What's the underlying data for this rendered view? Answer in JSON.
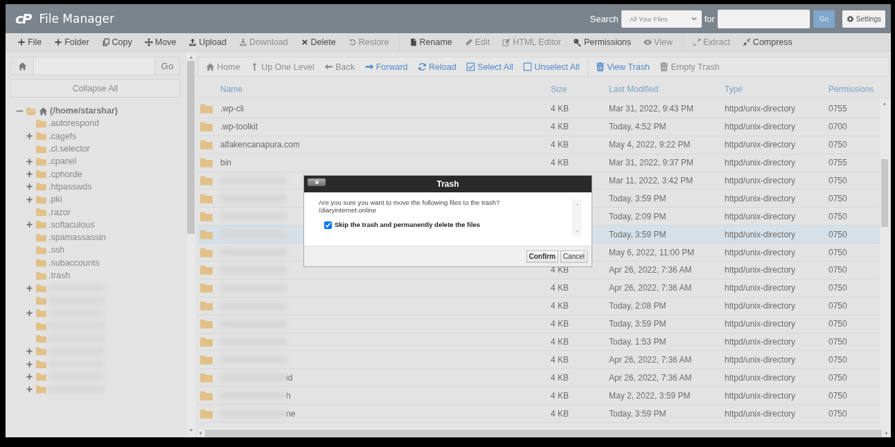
{
  "header": {
    "logo": "cP",
    "title": "File Manager",
    "search_label": "Search",
    "search_scope": "All Your Files",
    "for_label": "for",
    "go": "Go",
    "settings": "Settings"
  },
  "toolbar": {
    "groups": [
      [
        {
          "label": "File",
          "disabled": false
        },
        {
          "label": "Folder",
          "disabled": false
        },
        {
          "label": "Copy",
          "disabled": false
        },
        {
          "label": "Move",
          "disabled": false
        },
        {
          "label": "Upload",
          "disabled": false
        },
        {
          "label": "Download",
          "disabled": true
        },
        {
          "label": "Delete",
          "disabled": false
        },
        {
          "label": "Restore",
          "disabled": true
        }
      ],
      [
        {
          "label": "Rename",
          "disabled": false
        },
        {
          "label": "Edit",
          "disabled": true
        },
        {
          "label": "HTML Editor",
          "disabled": true
        },
        {
          "label": "Permissions",
          "disabled": false
        },
        {
          "label": "View",
          "disabled": true
        }
      ],
      [
        {
          "label": "Extract",
          "disabled": true
        },
        {
          "label": "Compress",
          "disabled": false
        }
      ]
    ]
  },
  "sidebar": {
    "go": "Go",
    "collapse": "Collapse All",
    "tree": {
      "label": "(/home/starshar)",
      "expanded": true,
      "children": [
        {
          "label": ".autorespond",
          "expandable": false
        },
        {
          "label": ".cagefs",
          "expandable": true
        },
        {
          "label": ".cl.selector",
          "expandable": false
        },
        {
          "label": ".cpanel",
          "expandable": true
        },
        {
          "label": ".cphorde",
          "expandable": true
        },
        {
          "label": ".htpasswds",
          "expandable": true
        },
        {
          "label": ".pki",
          "expandable": true
        },
        {
          "label": ".razor",
          "expandable": false
        },
        {
          "label": ".softaculous",
          "expandable": true
        },
        {
          "label": ".spamassassin",
          "expandable": false
        },
        {
          "label": ".ssh",
          "expandable": false
        },
        {
          "label": ".subaccounts",
          "expandable": false
        },
        {
          "label": ".trash",
          "expandable": false
        },
        {
          "redacted": true,
          "expandable": true
        },
        {
          "redacted": true,
          "expandable": false
        },
        {
          "redacted": true,
          "expandable": true
        },
        {
          "redacted": true,
          "expandable": false
        },
        {
          "redacted": true,
          "expandable": false
        },
        {
          "redacted": true,
          "expandable": true
        },
        {
          "redacted": true,
          "expandable": true
        },
        {
          "redacted": true,
          "expandable": true
        },
        {
          "redacted": true,
          "expandable": true
        }
      ]
    }
  },
  "nav": {
    "groups": [
      [
        {
          "label": "Home",
          "disabled": true
        },
        {
          "label": "Up One Level",
          "disabled": true
        },
        {
          "label": "Back",
          "disabled": true
        },
        {
          "label": "Forward",
          "disabled": false
        },
        {
          "label": "Reload",
          "disabled": false
        },
        {
          "label": "Select All",
          "disabled": false
        },
        {
          "label": "Unselect All",
          "disabled": false
        }
      ],
      [
        {
          "label": "View Trash",
          "disabled": false
        },
        {
          "label": "Empty Trash",
          "disabled": true
        }
      ]
    ]
  },
  "table": {
    "columns": [
      "Name",
      "Size",
      "Last Modified",
      "Type",
      "Permissions"
    ],
    "rows": [
      {
        "name": ".wp-cli",
        "size": "4 KB",
        "modified": "Mar 31, 2022, 9:43 PM",
        "type": "httpd/unix-directory",
        "permissions": "0755",
        "selected": false
      },
      {
        "name": ".wp-toolkit",
        "size": "4 KB",
        "modified": "Today, 4:52 PM",
        "type": "httpd/unix-directory",
        "permissions": "0700",
        "selected": false
      },
      {
        "name": "alfakencanapura.com",
        "size": "4 KB",
        "modified": "May 4, 2022, 9:22 PM",
        "type": "httpd/unix-directory",
        "permissions": "0750",
        "selected": false
      },
      {
        "name": "bin",
        "size": "4 KB",
        "modified": "Mar 31, 2022, 9:37 PM",
        "type": "httpd/unix-directory",
        "permissions": "0755",
        "selected": false
      },
      {
        "redacted": true,
        "modified": "Mar 11, 2022, 3:42 PM",
        "type": "httpd/unix-directory",
        "permissions": "0750",
        "selected": false
      },
      {
        "redacted": true,
        "modified": "Today, 3:59 PM",
        "type": "httpd/unix-directory",
        "permissions": "0750",
        "selected": false
      },
      {
        "redacted": true,
        "modified": "Today, 2:09 PM",
        "type": "httpd/unix-directory",
        "permissions": "0750",
        "selected": false
      },
      {
        "redacted": true,
        "modified": "Today, 3:59 PM",
        "type": "httpd/unix-directory",
        "permissions": "0750",
        "selected": true
      },
      {
        "redacted": true,
        "modified": "May 6, 2022, 11:00 PM",
        "type": "httpd/unix-directory",
        "permissions": "0750",
        "selected": false
      },
      {
        "redacted": true,
        "size": "4 KB",
        "modified": "Apr 26, 2022, 7:36 AM",
        "type": "httpd/unix-directory",
        "permissions": "0750",
        "selected": false
      },
      {
        "redacted": true,
        "size": "4 KB",
        "modified": "Apr 26, 2022, 7:36 AM",
        "type": "httpd/unix-directory",
        "permissions": "0750",
        "selected": false
      },
      {
        "redacted": true,
        "size": "4 KB",
        "modified": "Today, 2:08 PM",
        "type": "httpd/unix-directory",
        "permissions": "0750",
        "selected": false
      },
      {
        "redacted": true,
        "size": "4 KB",
        "modified": "Today, 3:59 PM",
        "type": "httpd/unix-directory",
        "permissions": "0750",
        "selected": false
      },
      {
        "redacted": true,
        "size": "4 KB",
        "modified": "Today, 1:53 PM",
        "type": "httpd/unix-directory",
        "permissions": "0750",
        "selected": false
      },
      {
        "redacted": true,
        "size": "4 KB",
        "modified": "Apr 26, 2022, 7:36 AM",
        "type": "httpd/unix-directory",
        "permissions": "0750",
        "selected": false
      },
      {
        "redacted": true,
        "name_tail": "id",
        "size": "4 KB",
        "modified": "Apr 26, 2022, 7:36 AM",
        "type": "httpd/unix-directory",
        "permissions": "0750",
        "selected": false
      },
      {
        "redacted": true,
        "name_tail": "h",
        "size": "4 KB",
        "modified": "May 2, 2022, 3:59 PM",
        "type": "httpd/unix-directory",
        "permissions": "0750",
        "selected": false
      },
      {
        "redacted": true,
        "name_tail": "ne",
        "size": "4 KB",
        "modified": "Today, 3:59 PM",
        "type": "httpd/unix-directory",
        "permissions": "0750",
        "selected": false
      }
    ]
  },
  "dialog": {
    "title": "Trash",
    "message": "Are you sure you want to move the following files to the trash?",
    "path": "/diaryinternet.online",
    "skip_label": "Skip the trash and permanently delete the files",
    "skip_checked": true,
    "buttons": [
      "Confirm",
      "Cancel"
    ]
  }
}
